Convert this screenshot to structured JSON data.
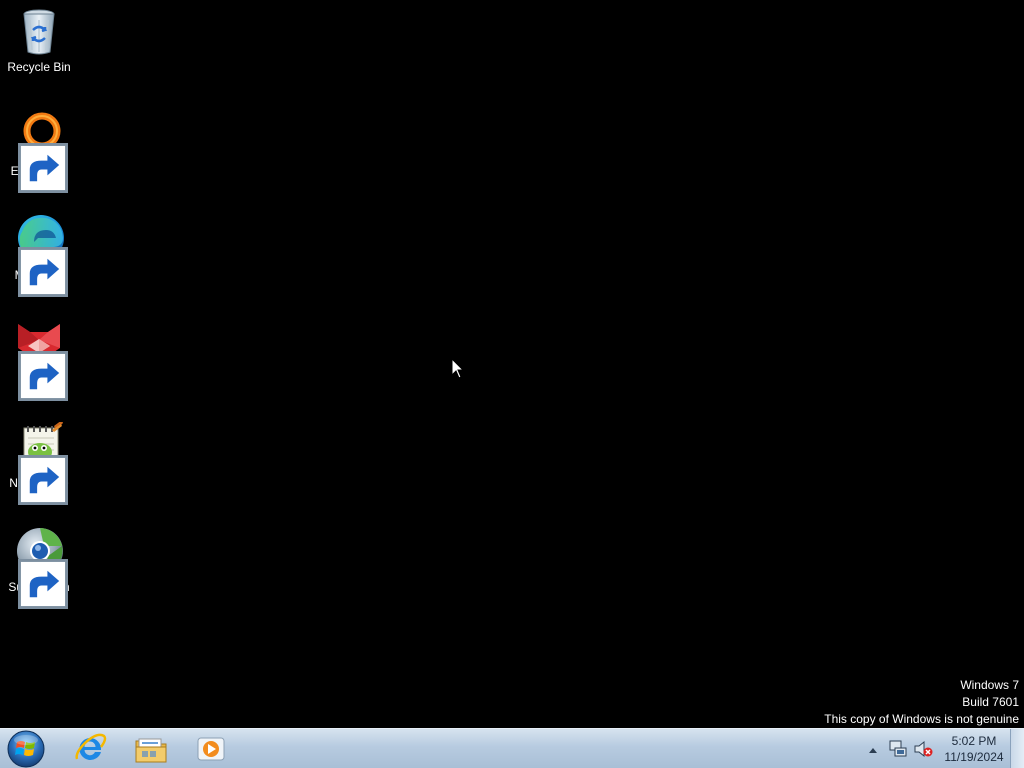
{
  "desktop": {
    "icons": [
      {
        "label": "Recycle Bin",
        "icon": "recycle-bin-icon",
        "shortcut": false
      },
      {
        "label": "Everything",
        "icon": "everything-icon",
        "shortcut": true
      },
      {
        "label": "Microsoft Edge",
        "icon": "edge-icon",
        "shortcut": true
      },
      {
        "label": "r3dfox",
        "icon": "r3dfox-icon",
        "shortcut": true
      },
      {
        "label": "Notepad++",
        "icon": "notepadpp-icon",
        "shortcut": true
      },
      {
        "label": "Supermium",
        "icon": "supermium-icon",
        "shortcut": true
      }
    ]
  },
  "watermark": {
    "line1": "Windows 7",
    "line2": "Build 7601",
    "line3": "This copy of Windows is not genuine"
  },
  "taskbar": {
    "start_icon": "windows-start-icon",
    "pinned": [
      {
        "name": "internet-explorer",
        "icon": "internet-explorer-icon"
      },
      {
        "name": "windows-explorer",
        "icon": "folder-icon"
      },
      {
        "name": "windows-media-player",
        "icon": "media-player-icon"
      }
    ],
    "tray": {
      "show_hidden_icon": "triangle-up-icon",
      "network_icon": "network-icon",
      "volume_icon": "volume-muted-icon"
    },
    "clock": {
      "time": "5:02 PM",
      "date": "11/19/2024"
    }
  },
  "colors": {
    "desktop_background": "#000000",
    "taskbar_top": "#d6e3ef",
    "taskbar_bottom": "#a9bfd6"
  }
}
